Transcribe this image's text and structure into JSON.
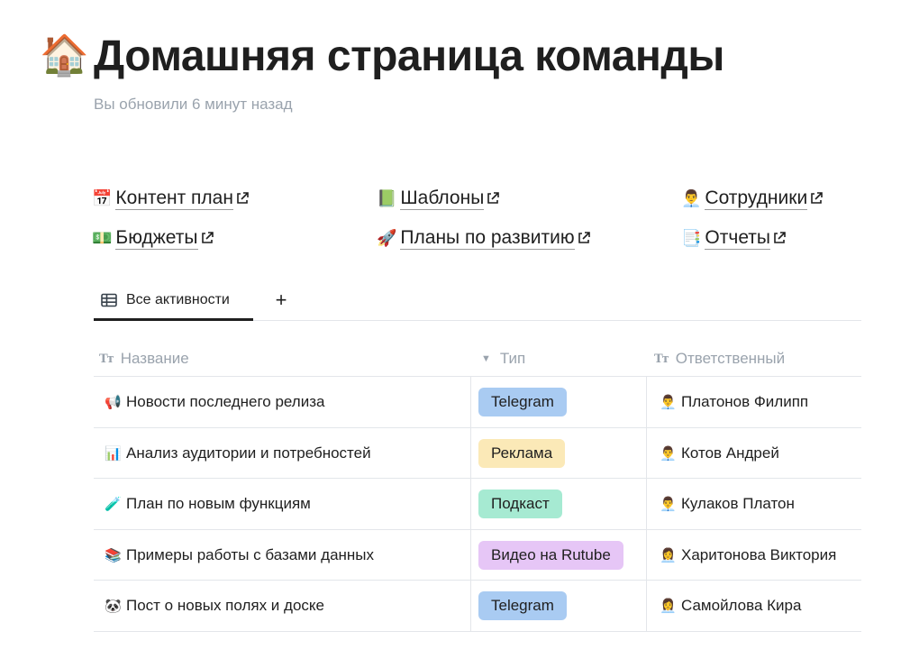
{
  "page": {
    "icon": "🏠",
    "title": "Домашняя страница команды",
    "subtitle": "Вы обновили 6 минут назад"
  },
  "links": [
    {
      "emoji": "📅",
      "label": "Контент план"
    },
    {
      "emoji": "📗",
      "label": "Шаблоны"
    },
    {
      "emoji": "👨‍💼",
      "label": "Сотрудники"
    },
    {
      "emoji": "💵",
      "label": "Бюджеты"
    },
    {
      "emoji": "🚀",
      "label": "Планы по развитию"
    },
    {
      "emoji": "📑",
      "label": "Отчеты"
    }
  ],
  "tabs": {
    "active_label": "Все активности",
    "add_label": "+"
  },
  "table": {
    "headers": {
      "name": "Название",
      "type": "Тип",
      "owner": "Ответственный"
    },
    "header_icons": {
      "text": "Tт",
      "select": "▼"
    },
    "rows": [
      {
        "emoji": "📢",
        "name": "Новости последнего релиза",
        "type": "Telegram",
        "type_color": "#a9cbf2",
        "owner_emoji": "👨‍💼",
        "owner": "Платонов Филипп"
      },
      {
        "emoji": "📊",
        "name": "Анализ аудитории и потребностей",
        "type": "Реклама",
        "type_color": "#fbe9b7",
        "owner_emoji": "👨‍💼",
        "owner": "Котов Андрей"
      },
      {
        "emoji": "🧪",
        "name": "План по новым функциям",
        "type": "Подкаст",
        "type_color": "#a6ead2",
        "owner_emoji": "👨‍💼",
        "owner": "Кулаков Платон"
      },
      {
        "emoji": "📚",
        "name": "Примеры работы с базами данных",
        "type": "Видео на Rutube",
        "type_color": "#e6c6f6",
        "owner_emoji": "👩‍💼",
        "owner": "Харитонова Виктория"
      },
      {
        "emoji": "🐼",
        "name": "Пост о новых полях и доске",
        "type": "Telegram",
        "type_color": "#a9cbf2",
        "owner_emoji": "👩‍💼",
        "owner": "Самойлова Кира"
      }
    ]
  }
}
